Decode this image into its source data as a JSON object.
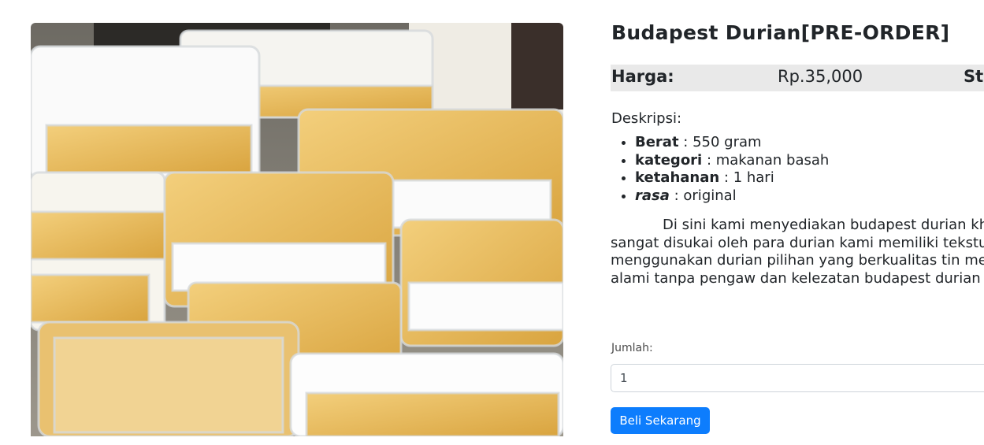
{
  "product": {
    "title": "Budapest Durian[PRE-ORDER]",
    "image_alt": "Budapest durian cakes packed in clear plastic containers"
  },
  "price": {
    "label": "Harga:",
    "value": "Rp.35,000",
    "stock_label": "Stok"
  },
  "description": {
    "heading": "Deskripsi:",
    "specs": [
      {
        "key": "Berat",
        "value": " : 550 gram"
      },
      {
        "key": "kategori",
        "value": " : makanan basah"
      },
      {
        "key": " ketahanan",
        "value": " : 1 hari"
      },
      {
        "key": "rasa",
        "value": " : original"
      }
    ],
    "paragraph": "Di sini kami menyediakan budapest durian khas dan lezat, sehingga sangat disukai oleh para durian kami memiliki tekstur yang lembut dan ke menggunakan durian pilihan yang berkualitas tin menggunakan bahan-bahan alami tanpa pengaw dan kelezatan budapest durian kami."
  },
  "quantity": {
    "label": "Jumlah:",
    "value": "1"
  },
  "actions": {
    "buy_label": "Beli Sekarang"
  },
  "colors": {
    "primary": "#0d7dfd",
    "price_bar_bg": "#e9e9e9"
  }
}
